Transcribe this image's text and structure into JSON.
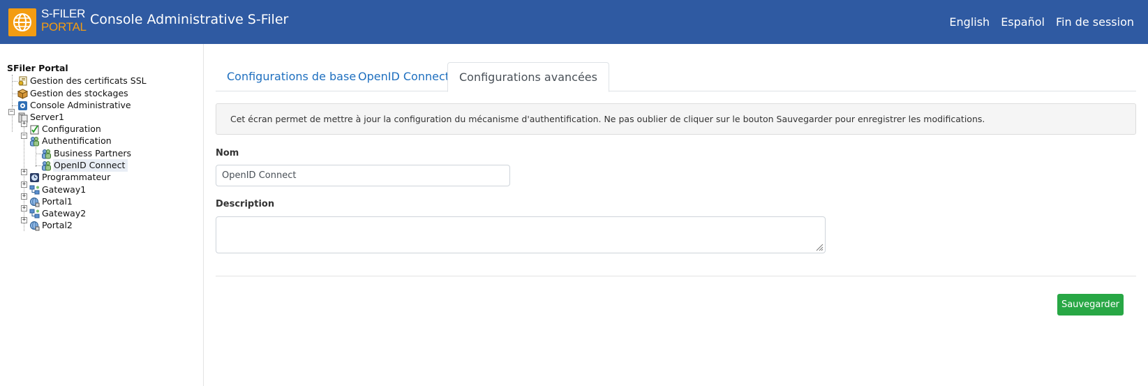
{
  "header": {
    "brand_line1": "S-FILER",
    "brand_line2": "PORTAL",
    "title": "Console Administrative S-Filer",
    "links": {
      "english": "English",
      "espanol": "Español",
      "logout": "Fin de session"
    }
  },
  "sidebar": {
    "root": "SFiler Portal",
    "items": {
      "ssl": "Gestion des certificats SSL",
      "storage": "Gestion des stockages",
      "console": "Console Administrative",
      "server1": "Server1",
      "configuration": "Configuration",
      "authentication": "Authentification",
      "business_partners": "Business Partners",
      "openid": "OpenID Connect",
      "scheduler": "Programmateur",
      "gateway1": "Gateway1",
      "portal1": "Portal1",
      "gateway2": "Gateway2",
      "portal2": "Portal2"
    },
    "selected": "OpenID Connect"
  },
  "tabs": {
    "basic": "Configurations de base",
    "openid": "OpenID Connect",
    "advanced": "Configurations avancées",
    "active": "Configurations avancées"
  },
  "form": {
    "info": "Cet écran permet de mettre à jour la configuration du mécanisme d'authentification. Ne pas oublier de cliquer sur le bouton Sauvegarder pour enregistrer les modifications.",
    "name_label": "Nom",
    "name_value": "OpenID Connect",
    "description_label": "Description",
    "description_value": "",
    "save_label": "Sauvegarder"
  },
  "colors": {
    "header_bg": "#2f5aa2",
    "brand_orange": "#f39c12",
    "link_blue": "#1e6fbf",
    "save_green": "#28a745"
  }
}
